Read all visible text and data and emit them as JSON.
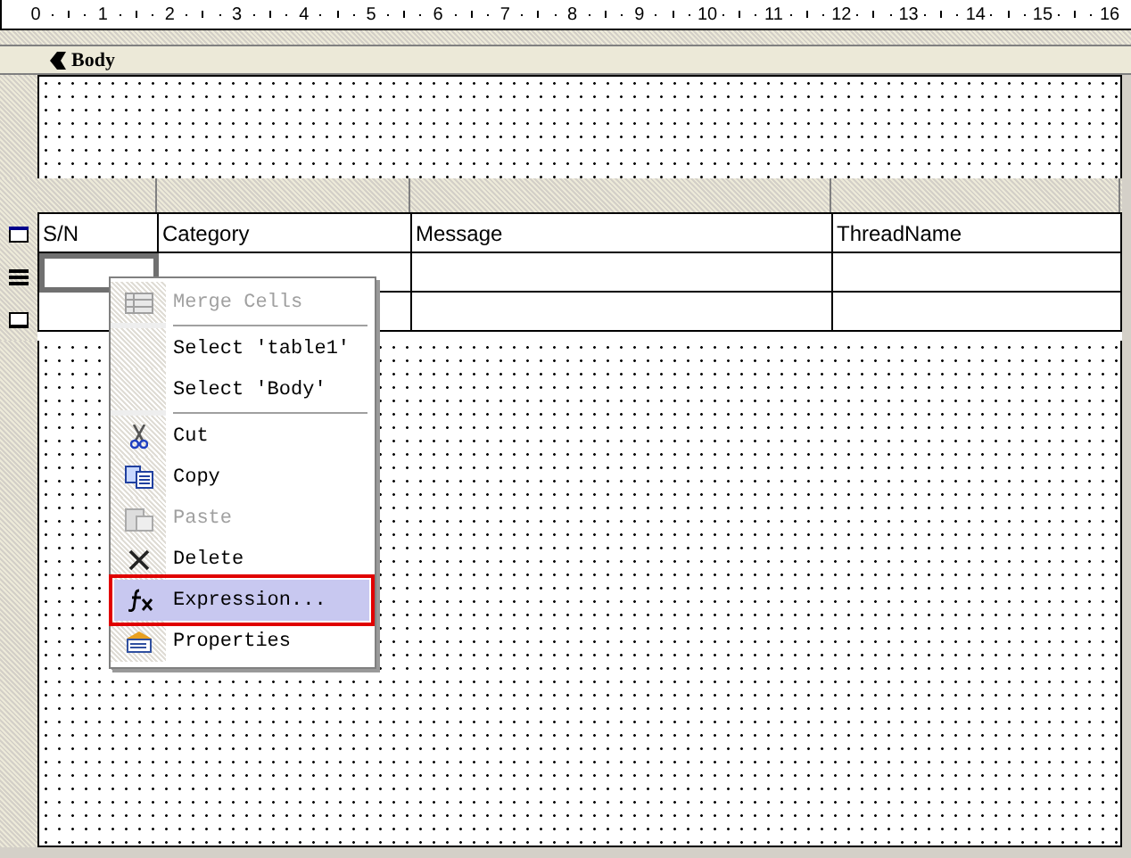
{
  "ruler": {
    "ticks": [
      "0",
      "1",
      "2",
      "3",
      "4",
      "5",
      "6",
      "7",
      "8",
      "9",
      "10",
      "11",
      "12",
      "13",
      "14",
      "15",
      "16"
    ]
  },
  "band": {
    "label": "Body"
  },
  "table": {
    "columns": [
      "S/N",
      "Category",
      "Message",
      "ThreadName"
    ],
    "row_markers": [
      {
        "kind": "header"
      },
      {
        "kind": "detail"
      },
      {
        "kind": "footer"
      }
    ],
    "rows": [
      {
        "cells": [
          {
            "selected": true
          },
          {
            "selected": false
          },
          {
            "selected": false
          },
          {
            "selected": false
          }
        ]
      },
      {
        "cells": [
          {
            "selected": false
          },
          {
            "selected": false
          },
          {
            "selected": false
          },
          {
            "selected": false
          }
        ]
      }
    ]
  },
  "context_menu": {
    "items": [
      {
        "kind": "item",
        "label": "Merge Cells",
        "disabled": true,
        "selected": false
      },
      {
        "kind": "separator"
      },
      {
        "kind": "item",
        "label": "Select 'table1'",
        "disabled": false,
        "selected": false
      },
      {
        "kind": "item",
        "label": "Select 'Body'",
        "disabled": false,
        "selected": false
      },
      {
        "kind": "separator"
      },
      {
        "kind": "item",
        "label": "Cut",
        "disabled": false,
        "selected": false
      },
      {
        "kind": "item",
        "label": "Copy",
        "disabled": false,
        "selected": false
      },
      {
        "kind": "item",
        "label": "Paste",
        "disabled": true,
        "selected": false
      },
      {
        "kind": "item",
        "label": "Delete",
        "disabled": false,
        "selected": false
      },
      {
        "kind": "item",
        "label": "Expression...",
        "disabled": false,
        "selected": true
      },
      {
        "kind": "item",
        "label": "Properties",
        "disabled": false,
        "selected": false
      }
    ]
  }
}
